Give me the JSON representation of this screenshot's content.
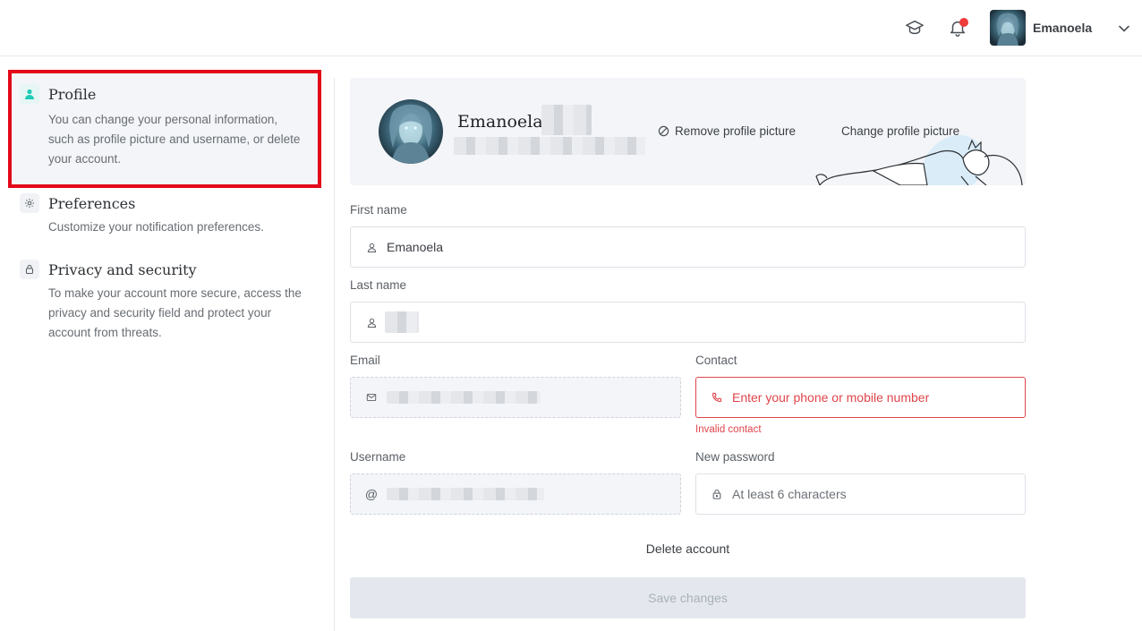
{
  "header": {
    "user_name": "Emanoela",
    "icons": [
      "graduation-cap-icon",
      "bell-icon",
      "chevron-down-icon"
    ],
    "notification_color": "#ee3b3b"
  },
  "sidebar": {
    "items": [
      {
        "title": "Profile",
        "description": "You can change your personal information, such as profile picture and username, or delete your account.",
        "icon": "user-icon",
        "active": true
      },
      {
        "title": "Preferences",
        "description": "Customize your notification preferences.",
        "icon": "gear-icon",
        "active": false
      },
      {
        "title": "Privacy and security",
        "description": "To make your account more secure, access the privacy and security field and protect your account from threats.",
        "icon": "lock-icon",
        "active": false
      }
    ],
    "accent_color": "#1ecbb6",
    "highlight_color": "#e3081a"
  },
  "profile": {
    "name": "Emanoela",
    "remove_picture": "Remove profile picture",
    "change_picture": "Change profile picture"
  },
  "form": {
    "first_name": {
      "label": "First name",
      "value": "Emanoela"
    },
    "last_name": {
      "label": "Last name",
      "value": ""
    },
    "email": {
      "label": "Email",
      "value": ""
    },
    "contact": {
      "label": "Contact",
      "placeholder": "Enter your phone or mobile number",
      "error": "Invalid contact"
    },
    "username": {
      "label": "Username",
      "value": ""
    },
    "new_password": {
      "label": "New password",
      "placeholder": "At least 6 characters"
    },
    "delete_account": "Delete account",
    "save_changes": "Save changes",
    "error_color": "#e0454b"
  }
}
